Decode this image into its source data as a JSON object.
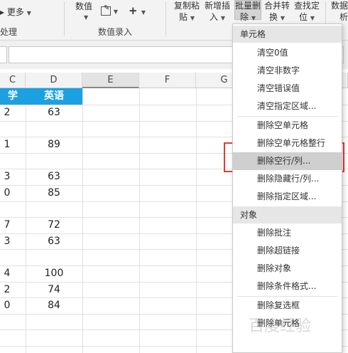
{
  "ribbon": {
    "more_label": "更多",
    "group_left_label": "处理",
    "numeric_label": "数值",
    "group_numeric_label": "数值录入",
    "plus_label": "+",
    "copy_paste": [
      "复制粘",
      "贴"
    ],
    "new_insert": [
      "新增插",
      "入"
    ],
    "batch_delete": [
      "批量删",
      "除"
    ],
    "merge_convert": [
      "合并转",
      "换"
    ],
    "find_locate": [
      "查找定",
      "位"
    ],
    "data_analysis": [
      "数据分",
      "析"
    ]
  },
  "grid": {
    "columns": [
      "D",
      "E",
      "F",
      "G"
    ],
    "partial_column_letter": "C",
    "headers": {
      "left_partial": "学",
      "D": "英语"
    },
    "rows": [
      {
        "left": "2",
        "D": "63"
      },
      {
        "left": "",
        "D": ""
      },
      {
        "left": "1",
        "D": "89"
      },
      {
        "left": "",
        "D": ""
      },
      {
        "left": "3",
        "D": "63"
      },
      {
        "left": "0",
        "D": "85"
      },
      {
        "left": "",
        "D": ""
      },
      {
        "left": "7",
        "D": "72"
      },
      {
        "left": "3",
        "D": "63"
      },
      {
        "left": "",
        "D": ""
      },
      {
        "left": "4",
        "D": "100"
      },
      {
        "left": "2",
        "D": "74"
      },
      {
        "left": "0",
        "D": "84"
      },
      {
        "left": "",
        "D": ""
      },
      {
        "left": "",
        "D": ""
      }
    ]
  },
  "menu": {
    "section_cells": "单元格",
    "cells_items": [
      "清空0值",
      "清空非数字",
      "清空错误值",
      "清空指定区域...",
      "删除空单元格",
      "删除空单元格整行",
      "删除空行/列...",
      "删除隐藏行/列...",
      "删除指定区域..."
    ],
    "highlighted_item": "删除空行/列...",
    "section_objects": "对象",
    "object_items": [
      "删除批注",
      "删除超链接",
      "删除对象",
      "删除条件格式...",
      "删除复选框",
      "删除单元格"
    ]
  },
  "watermark": "百度经验",
  "colors": {
    "header_blue": "#1ba1e2",
    "highlight_red": "#e53935",
    "menu_hover": "#cfcfcf"
  }
}
